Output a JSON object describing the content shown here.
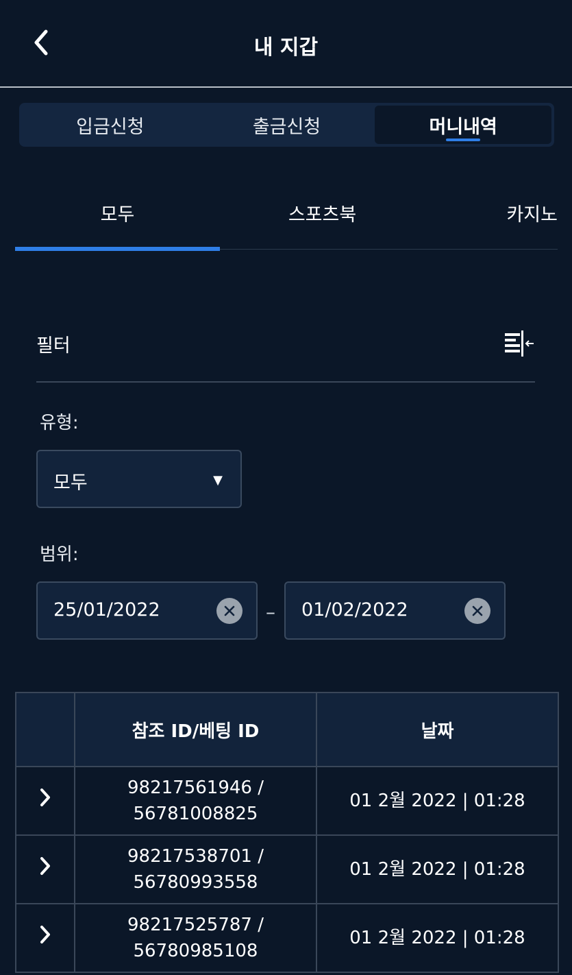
{
  "header": {
    "title": "내 지갑",
    "back_icon": "chevron-left-icon"
  },
  "segments": [
    {
      "label": "입금신청",
      "active": false
    },
    {
      "label": "출금신청",
      "active": false
    },
    {
      "label": "머니내역",
      "active": true
    }
  ],
  "tabs": [
    {
      "label": "모두",
      "active": true
    },
    {
      "label": "스포츠북",
      "active": false
    },
    {
      "label": "카지노",
      "active": false
    }
  ],
  "filter": {
    "label": "필터",
    "icon": "filter-collapse-icon"
  },
  "type_field": {
    "label": "유형:",
    "value": "모두"
  },
  "range_field": {
    "label": "범위:",
    "from": "25/01/2022",
    "separator": "–",
    "to": "01/02/2022"
  },
  "table": {
    "headers": [
      "",
      "참조 ID/베팅 ID",
      "날짜"
    ],
    "rows": [
      {
        "ref": "98217561946 /",
        "bet": "56781008825",
        "date": "01 2월 2022 | 01:28"
      },
      {
        "ref": "98217538701 /",
        "bet": "56780993558",
        "date": "01 2월 2022 | 01:28"
      },
      {
        "ref": "98217525787 /",
        "bet": "56780985108",
        "date": "01 2월 2022 | 01:28"
      }
    ]
  },
  "colors": {
    "background": "#0b1728",
    "accent": "#2f7ee6",
    "panel": "#12233b"
  }
}
